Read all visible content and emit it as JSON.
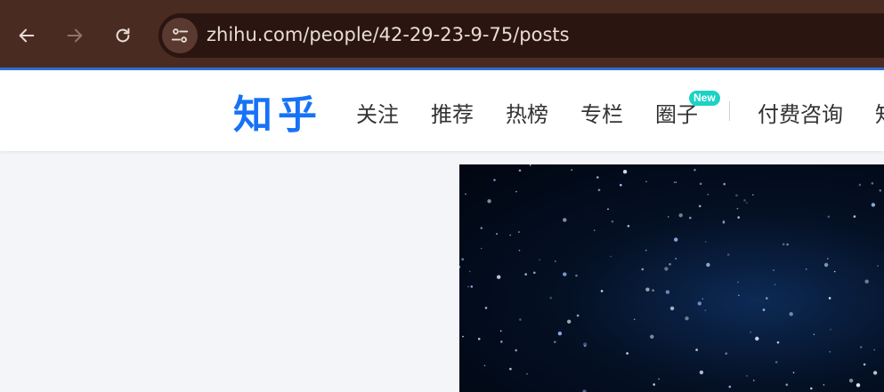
{
  "browser": {
    "url": "zhihu.com/people/42-29-23-9-75/posts",
    "back_icon": "arrow-left-icon",
    "forward_icon": "arrow-right-icon",
    "reload_icon": "reload-icon",
    "site_info_icon": "tune-icon"
  },
  "header": {
    "logo": "知乎",
    "nav": [
      "关注",
      "推荐",
      "热榜",
      "专栏",
      "圈子"
    ],
    "new_badge": "New",
    "nav_after_divider": [
      "付费咨询",
      "知"
    ]
  },
  "colors": {
    "brand": "#1772f6",
    "toolbar": "#4a2b21",
    "badge": "#1cd2c5"
  }
}
